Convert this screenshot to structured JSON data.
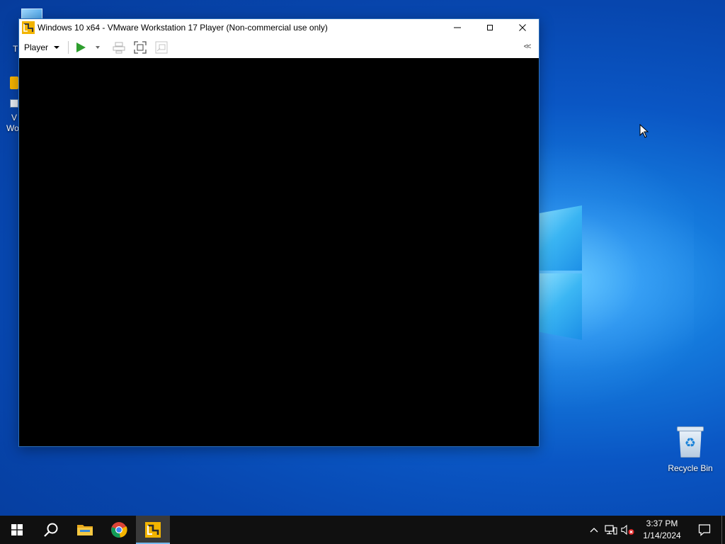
{
  "window": {
    "title": "Windows 10 x64 - VMware Workstation 17 Player (Non-commercial use only)",
    "app_icon": "vmware-player-icon",
    "minimize_icon": "minimize-icon",
    "maximize_icon": "maximize-icon",
    "close_icon": "close-icon"
  },
  "toolbar": {
    "player_menu_label": "Player",
    "play_icon": "play-icon",
    "send_ctrl_alt_del_icon": "ctrl-alt-del-icon",
    "fullscreen_icon": "fullscreen-icon",
    "unity_icon": "unity-icon",
    "collapse_label": "<<",
    "accent_color": "#2e9e2e"
  },
  "desktop": {
    "partial_icon_1_label": "T",
    "partial_icon_2_label_line1": "V",
    "partial_icon_2_label_line2": "Wo",
    "recycle_bin_label": "Recycle Bin"
  },
  "taskbar": {
    "items": [
      {
        "name": "start-button",
        "icon": "windows-logo-icon"
      },
      {
        "name": "search-button",
        "icon": "search-icon"
      },
      {
        "name": "file-explorer",
        "icon": "folder-icon"
      },
      {
        "name": "chrome",
        "icon": "chrome-icon"
      },
      {
        "name": "vmware-player",
        "icon": "vmware-player-icon",
        "active": true
      }
    ],
    "clock": {
      "time": "3:37 PM",
      "date": "1/14/2024"
    },
    "tray_icons": [
      "chevron-up-icon",
      "network-icon",
      "volume-muted-icon"
    ],
    "notification_icon": "notification-icon"
  }
}
